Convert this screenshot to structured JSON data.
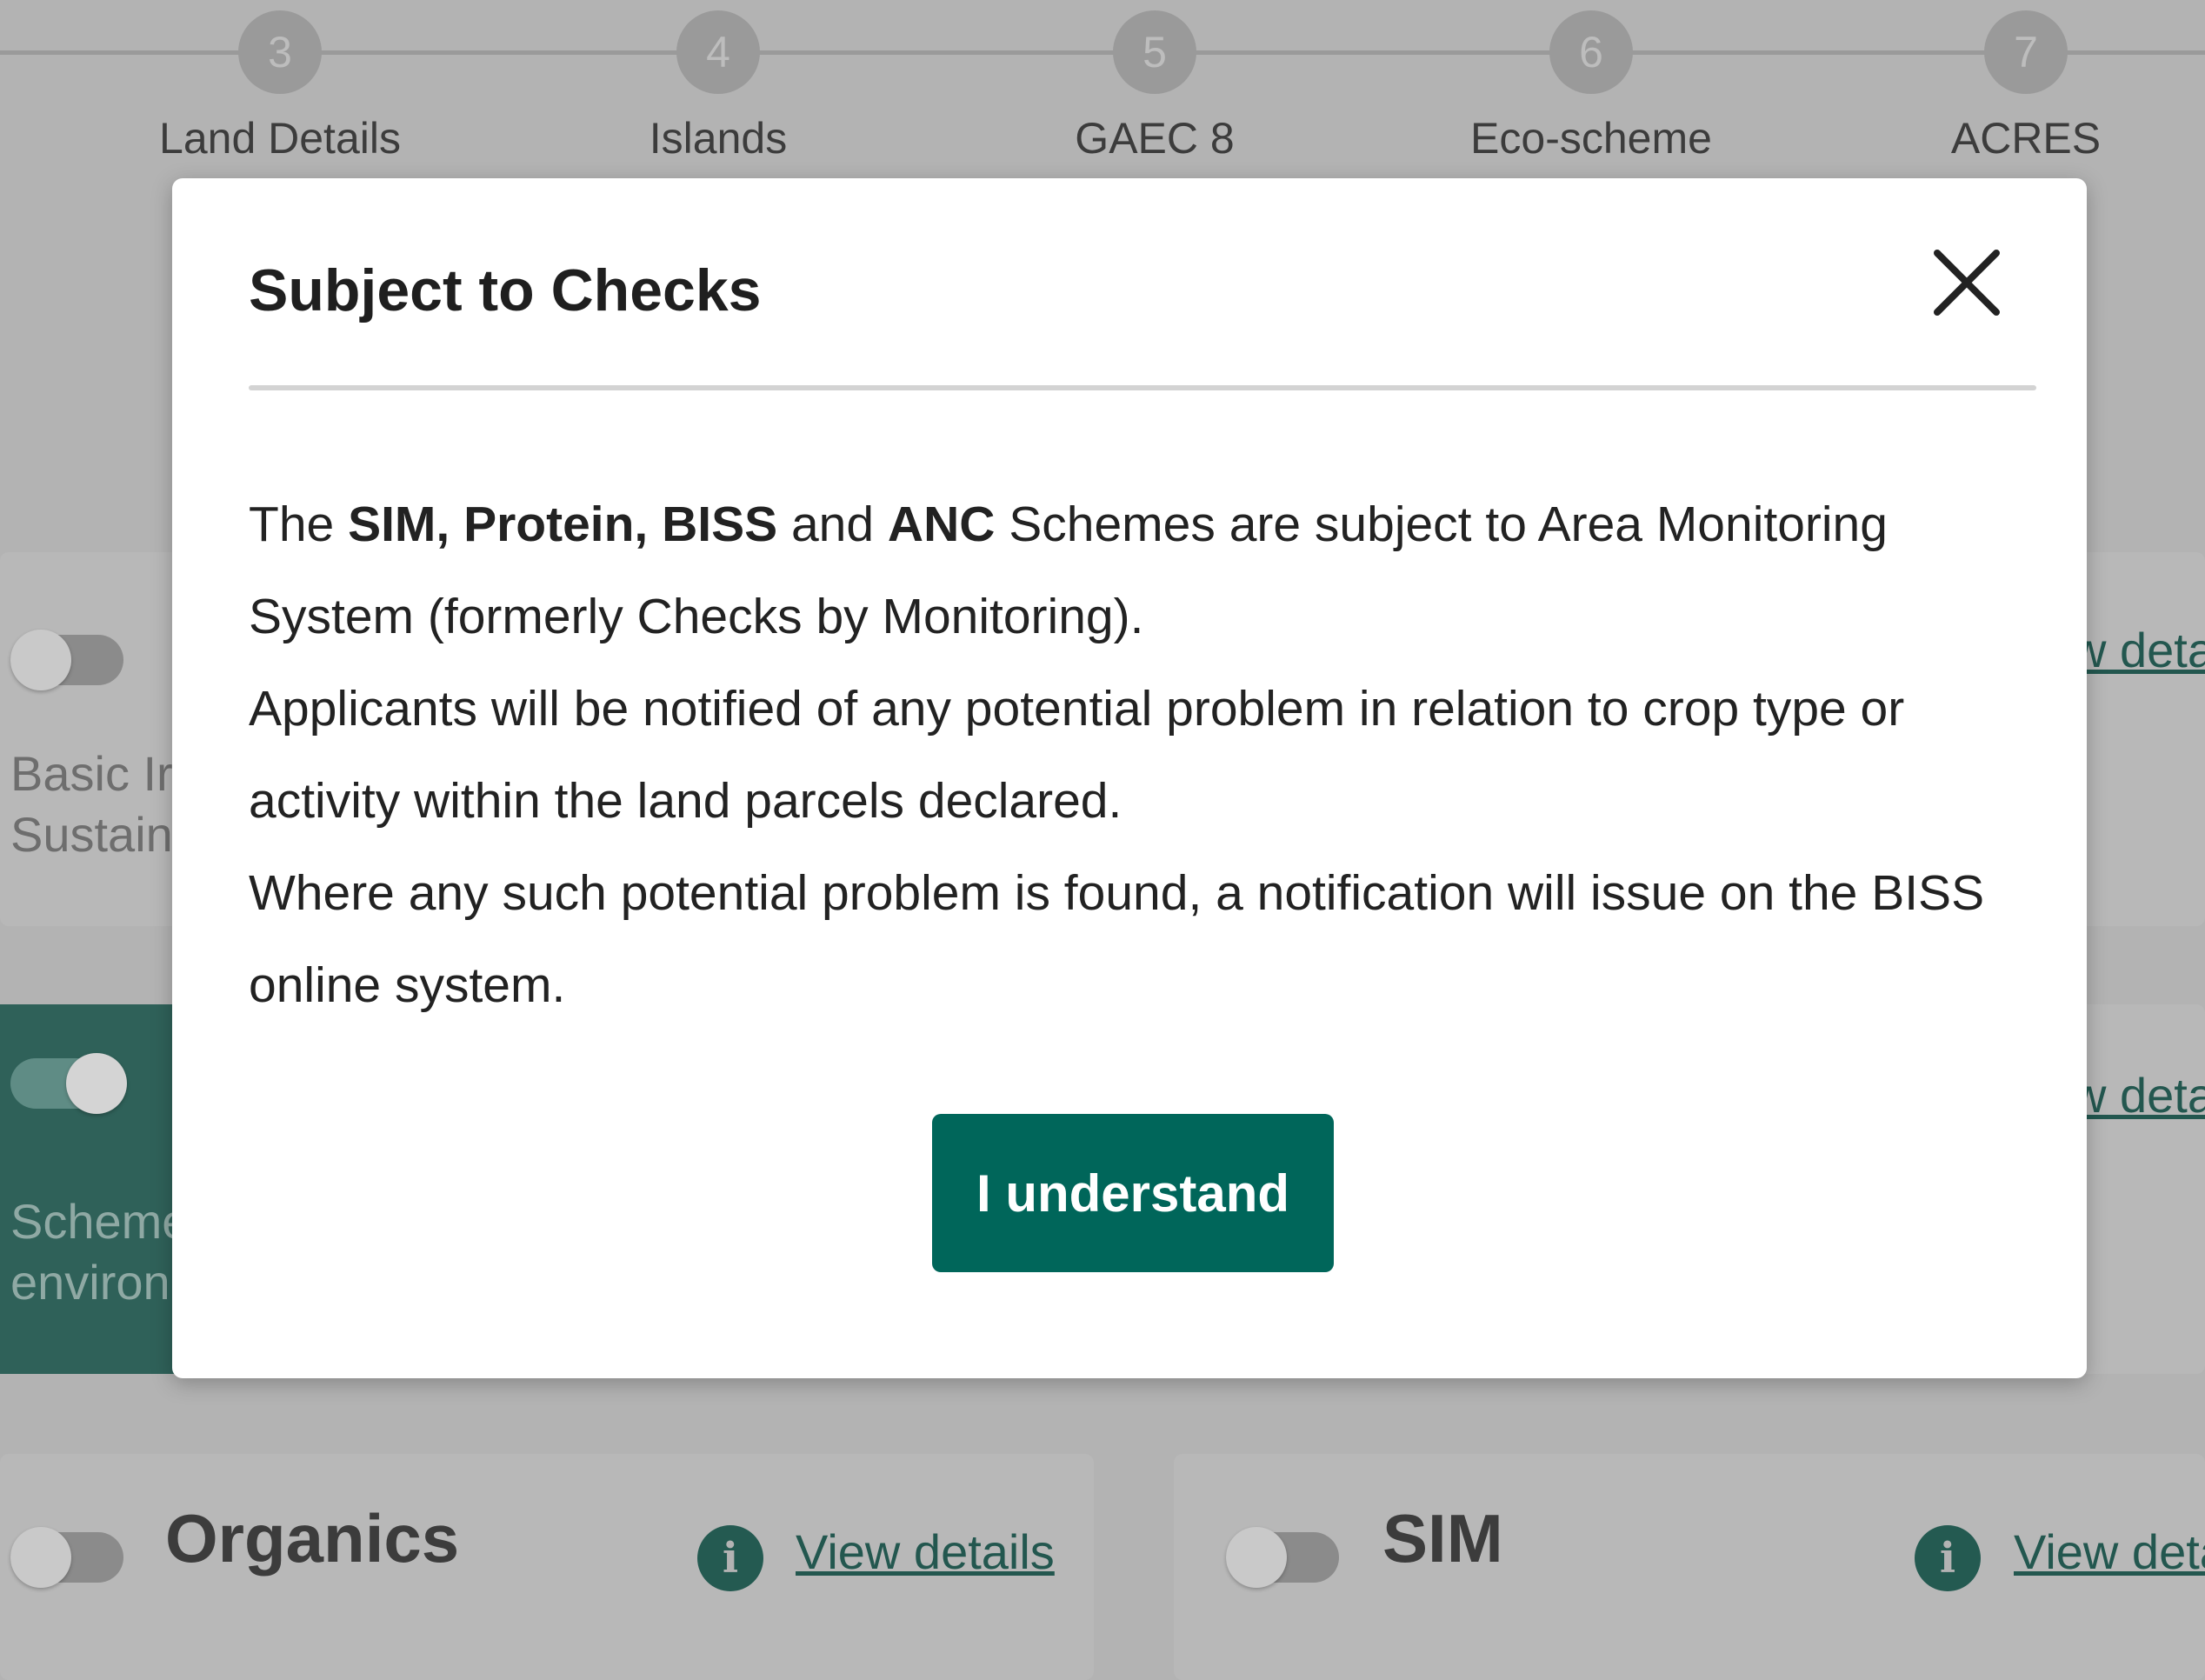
{
  "stepper": {
    "steps": [
      {
        "number": "3",
        "label": "Land Details"
      },
      {
        "number": "4",
        "label": "Islands"
      },
      {
        "number": "5",
        "label": "GAEC 8"
      },
      {
        "number": "6",
        "label": "Eco-scheme"
      },
      {
        "number": "7",
        "label": "ACRES"
      }
    ]
  },
  "cards": {
    "basic_income": {
      "desc_line1": "Basic Ir",
      "desc_line2": "Sustain",
      "link": "w deta"
    },
    "scheme_env": {
      "desc_line1": "Scheme",
      "desc_line2": "environ",
      "link": "w deta"
    },
    "organics": {
      "title": "Organics",
      "link": "View details"
    },
    "sim": {
      "title": "SIM",
      "link": "View deta"
    },
    "info_glyph": "i"
  },
  "modal": {
    "title": "Subject to Checks",
    "close_glyph": "✕",
    "p1": {
      "t1": "The ",
      "b1": "SIM, Protein, BISS",
      "t2": " and ",
      "b2": "ANC",
      "t3": " Schemes are subject to Area Monitoring System (formerly Checks by Monitoring)."
    },
    "p2": "Applicants will be notified of any potential problem in relation to crop type or activity within the land parcels declared.",
    "p3": "Where any such potential problem is found, a notification will issue on the BISS online system.",
    "button_label": "I understand"
  },
  "colors": {
    "primary": "#00665a",
    "overlay": "#b3b3b3",
    "teal_card": "#2f6159"
  }
}
